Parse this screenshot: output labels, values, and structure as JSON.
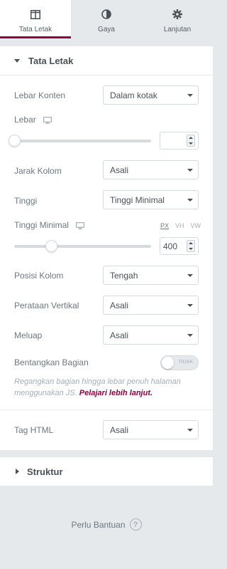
{
  "tabs": [
    {
      "label": "Tata Letak",
      "icon": "layout-columns-icon",
      "active": true
    },
    {
      "label": "Gaya",
      "icon": "half-circle-icon",
      "active": false
    },
    {
      "label": "Lanjutan",
      "icon": "gear-icon",
      "active": false
    }
  ],
  "section_layout": {
    "title": "Tata Letak",
    "content_width": {
      "label": "Lebar Konten",
      "value": "Dalam kotak"
    },
    "width": {
      "label": "Lebar",
      "value": "",
      "level": 0
    },
    "column_gap": {
      "label": "Jarak Kolom",
      "value": "Asali"
    },
    "height": {
      "label": "Tinggi",
      "value": "Tinggi Minimal"
    },
    "min_height": {
      "label": "Tinggi Minimal",
      "value": "400",
      "units": [
        "PX",
        "VH",
        "VW"
      ],
      "active_unit": "PX",
      "level": 0.27
    },
    "column_position": {
      "label": "Posisi Kolom",
      "value": "Tengah"
    },
    "vertical_align": {
      "label": "Perataan Vertikal",
      "value": "Asali"
    },
    "overflow": {
      "label": "Meluap",
      "value": "Asali"
    },
    "stretch": {
      "label": "Bentangkan Bagian",
      "switch_text": "TIDAK",
      "enabled": false
    },
    "stretch_desc": "Regangkan bagian hingga lebar penuh halaman menggunakan JS.",
    "stretch_link": "Pelajari lebih lanjut.",
    "html_tag": {
      "label": "Tag HTML",
      "value": "Asali"
    }
  },
  "section_structure": {
    "title": "Struktur"
  },
  "help": {
    "label": "Perlu Bantuan",
    "icon": "question-circle-icon"
  },
  "colors": {
    "accent": "#93003c",
    "background": "#e6e9ec",
    "text": "#6d7882"
  }
}
